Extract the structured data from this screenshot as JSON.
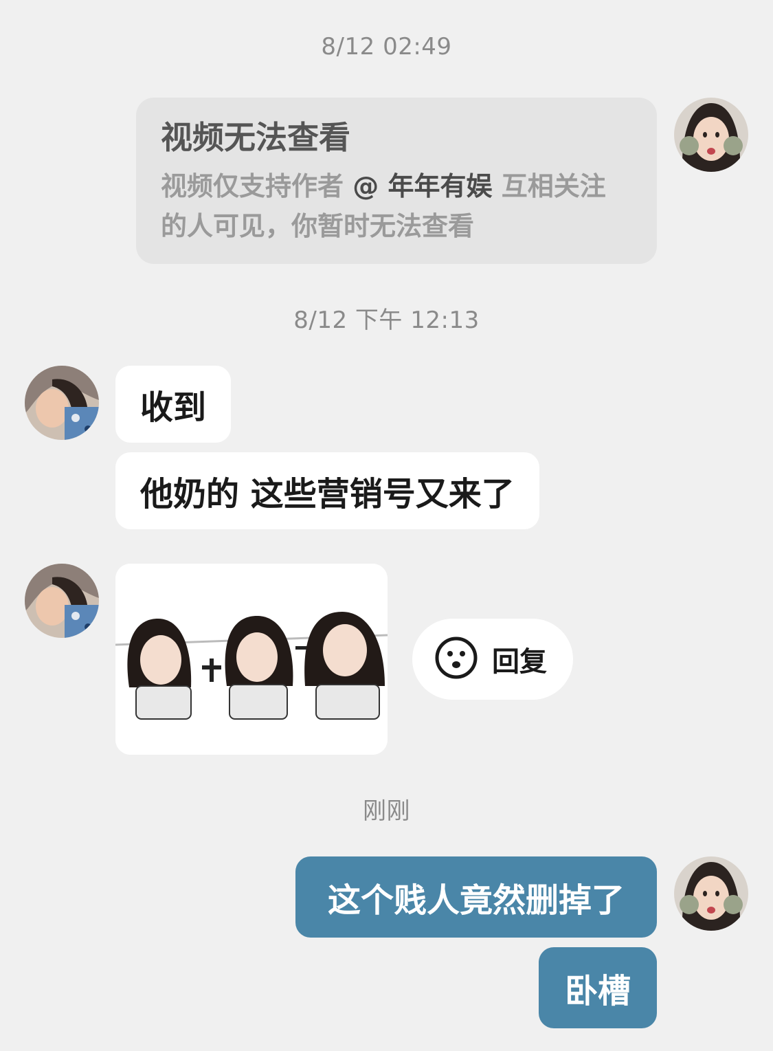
{
  "chat": {
    "timestamps": [
      "8/12 02:49",
      "8/12 下午 12:13",
      "刚刚"
    ],
    "video_card": {
      "title": "视频无法查看",
      "desc_prefix": "视频仅支持作者",
      "mention": "@ 年年有娱",
      "desc_suffix": "互相关注",
      "desc_line2": "的人可见，你暂时无法查看"
    },
    "incoming_messages": [
      "收到",
      "他奶的 这些营销号又来了"
    ],
    "reply_button": {
      "label": "回复",
      "icon": "smiley-face-icon"
    },
    "outgoing_messages": [
      "这个贱人竟然删掉了",
      "卧槽"
    ]
  },
  "colors": {
    "background": "#f0f0f0",
    "outgoing_bubble": "#4a86a8",
    "incoming_bubble": "#ffffff",
    "card": "#e4e4e4",
    "timestamp": "#8a8a8a"
  }
}
